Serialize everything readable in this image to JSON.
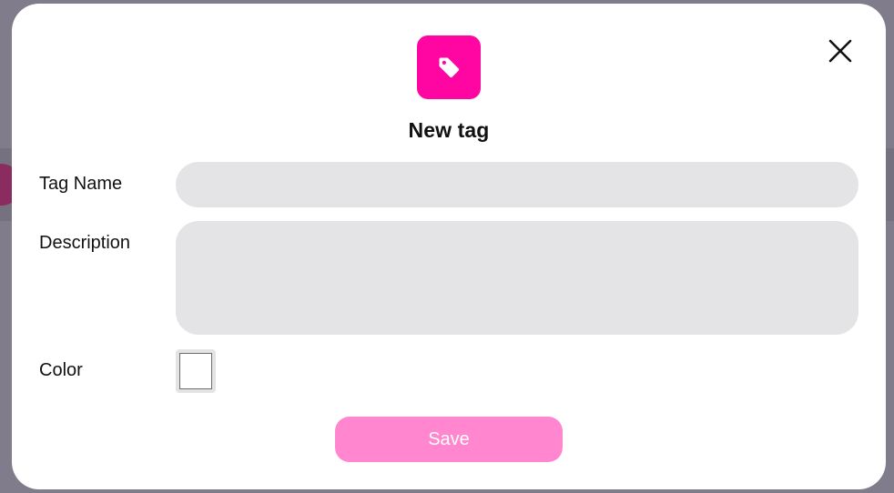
{
  "modal": {
    "title": "New tag",
    "accent_color": "#ff05a1",
    "badge_icon": "tag-icon",
    "close_icon": "close-icon"
  },
  "form": {
    "tag_name": {
      "label": "Tag Name",
      "value": "",
      "placeholder": ""
    },
    "description": {
      "label": "Description",
      "value": "",
      "placeholder": ""
    },
    "color": {
      "label": "Color",
      "value": "#ffffff"
    }
  },
  "actions": {
    "save_label": "Save",
    "save_color": "#ff86cf"
  }
}
